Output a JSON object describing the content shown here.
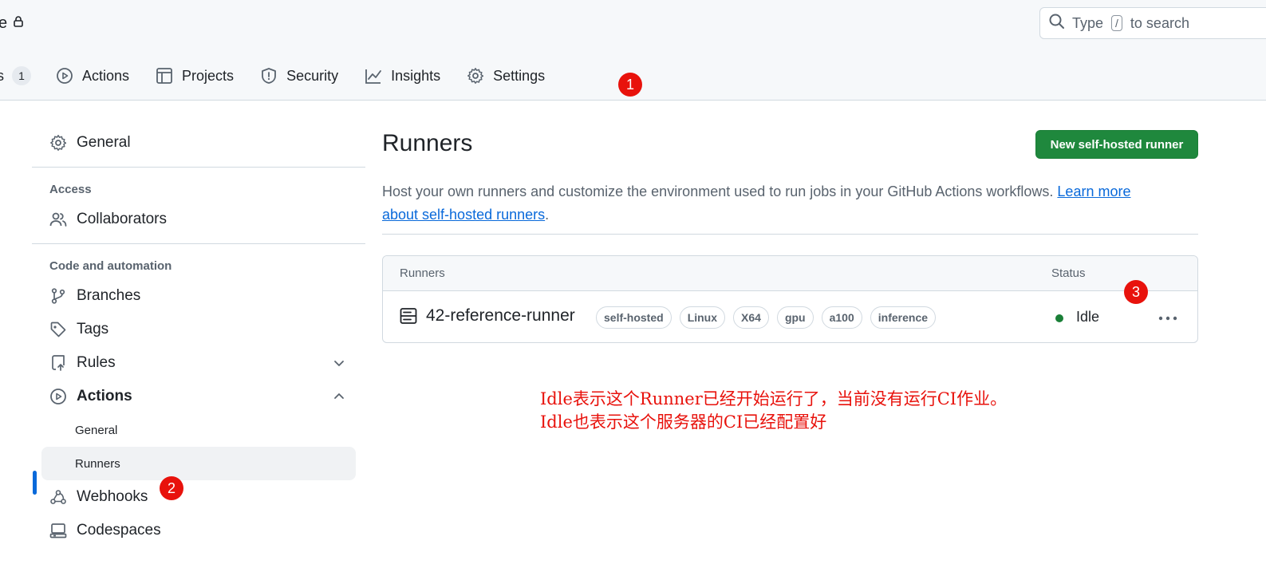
{
  "header": {
    "repo_fragment": "e",
    "search": {
      "prefix": "Type",
      "key": "/",
      "suffix": "to search"
    }
  },
  "tabs": {
    "fragment_label": "s",
    "fragment_count": "1",
    "items": [
      {
        "label": "Actions",
        "icon": "play-icon"
      },
      {
        "label": "Projects",
        "icon": "table-icon"
      },
      {
        "label": "Security",
        "icon": "shield-icon"
      },
      {
        "label": "Insights",
        "icon": "graph-icon"
      },
      {
        "label": "Settings",
        "icon": "gear-icon"
      }
    ]
  },
  "markers": [
    "1",
    "2",
    "3"
  ],
  "sidebar": {
    "general": "General",
    "access_heading": "Access",
    "collaborators": "Collaborators",
    "code_heading": "Code and automation",
    "branches": "Branches",
    "tags": "Tags",
    "rules": "Rules",
    "actions": "Actions",
    "actions_general": "General",
    "actions_runners": "Runners",
    "webhooks": "Webhooks",
    "codespaces": "Codespaces"
  },
  "main": {
    "title": "Runners",
    "new_button": "New self-hosted runner",
    "description": "Host your own runners and customize the environment used to run jobs in your GitHub Actions workflows.",
    "learn_more_1": "Learn more",
    "learn_more_2": "about self-hosted runners",
    "period": "."
  },
  "table": {
    "col_runners": "Runners",
    "col_status": "Status",
    "runner": {
      "name": "42-reference-runner",
      "labels": [
        "self-hosted",
        "Linux",
        "X64",
        "gpu",
        "a100",
        "inference"
      ],
      "status": "Idle",
      "status_color": "#1a7f37"
    }
  },
  "annotation": {
    "line1": "Idle表示这个Runner已经开始运行了，当前没有运行CI作业。",
    "line2": "Idle也表示这个服务器的CI已经配置好"
  },
  "colors": {
    "accent": "#0969da",
    "primary_button": "#1f883d",
    "annotation": "#e8120c"
  }
}
